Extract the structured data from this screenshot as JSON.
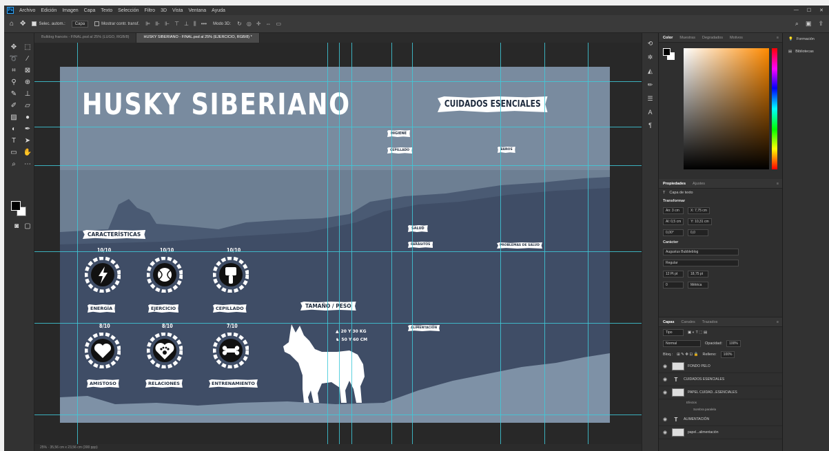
{
  "menubar": {
    "logo": "Ps",
    "items": [
      "Archivo",
      "Edición",
      "Imagen",
      "Capa",
      "Texto",
      "Selección",
      "Filtro",
      "3D",
      "Vista",
      "Ventana",
      "Ayuda"
    ],
    "window_controls": [
      "—",
      "☐",
      "✕"
    ]
  },
  "options": {
    "auto_select_label": "Selec. autom.:",
    "auto_select_value": "Capa",
    "transform_label": "Mostrar contr. transf.",
    "more": "•••",
    "mode_3d": "Modo 3D:"
  },
  "doc_tabs": [
    {
      "label": "Bulldog francés - FINAL.psd al 25% (LUGO, RGB/8)",
      "active": false
    },
    {
      "label": "HUSKY SIBERIANO - FINAL.psd al 25% (EJERCICIO, RGB/8) *",
      "active": true
    }
  ],
  "artboard": {
    "title": "HUSKY SIBERIANO",
    "care_title": "CUIDADOS ESENCIALES",
    "care_items": {
      "higiene": "HIGIENE",
      "cepillado": "CEPILLADO",
      "banos": "BAÑOS",
      "salud": "SALUD",
      "parasitos": "PARÁSITOS",
      "problemas": "PROBLEMAS DE SALUD",
      "alimentacion": "ALIMENTACIÓN"
    },
    "characteristics_title": "CARACTERÍSTICAS",
    "characteristics": [
      {
        "rating": "10/10",
        "label": "ENERGÍA",
        "icon": "lightning-icon"
      },
      {
        "rating": "10/10",
        "label": "EJERCICIO",
        "icon": "ball-icon"
      },
      {
        "rating": "10/10",
        "label": "CEPILLADO",
        "icon": "brush-icon"
      },
      {
        "rating": "8/10",
        "label": "AMISTOSO",
        "icon": "heart-icon"
      },
      {
        "rating": "8/10",
        "label": "RELACIONES",
        "icon": "paw-heart-icon"
      },
      {
        "rating": "7/10",
        "label": "ENTRENAMIENTO",
        "icon": "bone-icon"
      }
    ],
    "size_title": "TAMAÑO / PESO",
    "weight": "20 Y 30 KG",
    "height": "50 Y 60 CM"
  },
  "status": {
    "zoom_info": "25% · 35,56 cm x 23,56 cm (300 ppp)"
  },
  "color_panel": {
    "tabs": [
      "Color",
      "Muestras",
      "Degradados",
      "Motivos"
    ],
    "accent": "#ff8a00"
  },
  "properties_panel": {
    "tabs": [
      "Propiedades",
      "Ajustes"
    ],
    "layer_type": "Capa de texto",
    "transform_title": "Transformar",
    "fields": {
      "an": "An: 3 cm",
      "x": "X: 7,75 cm",
      "al": "Al: 0,5 cm",
      "y": "Y: 10,31 cm",
      "angle": "0,00°",
      "scale": "0,0"
    },
    "character_title": "Carácter",
    "font": "Augustus Bubbleblog",
    "style": "Regular",
    "size": "12 Pt pt",
    "leading": "18,75 pt",
    "tracking": "0",
    "kerning": "Métrica"
  },
  "layers_panel": {
    "tabs": [
      "Capas",
      "Canales",
      "Trazados"
    ],
    "search": "Tipo",
    "blend": "Normal",
    "opacity_label": "Opacidad:",
    "opacity": "100%",
    "lock_label": "Bloq.:",
    "fill_label": "Relleno:",
    "fill": "100%",
    "layers": [
      {
        "name": "FONDO PELO",
        "kind": "image"
      },
      {
        "name": "CUIDADOS ESENCIALES",
        "kind": "text"
      },
      {
        "name": "PAPEL CUIDAD...ESENCIALES",
        "kind": "image"
      },
      {
        "name": "ALIMENTACIÓN",
        "kind": "text"
      },
      {
        "name": "papel...alimentación",
        "kind": "image"
      }
    ],
    "effects": "Efectos",
    "drop_shadow": "Sombra paralela"
  },
  "far_right": {
    "items": [
      "Formación",
      "Bibliotecas"
    ]
  },
  "colors": {
    "guide": "#3fc9d8",
    "artboard_bg": "#6d7f93",
    "mountain_dark": "#39475e",
    "mountain_mid": "#3f4d66",
    "foreground_light": "#7e91a6"
  }
}
